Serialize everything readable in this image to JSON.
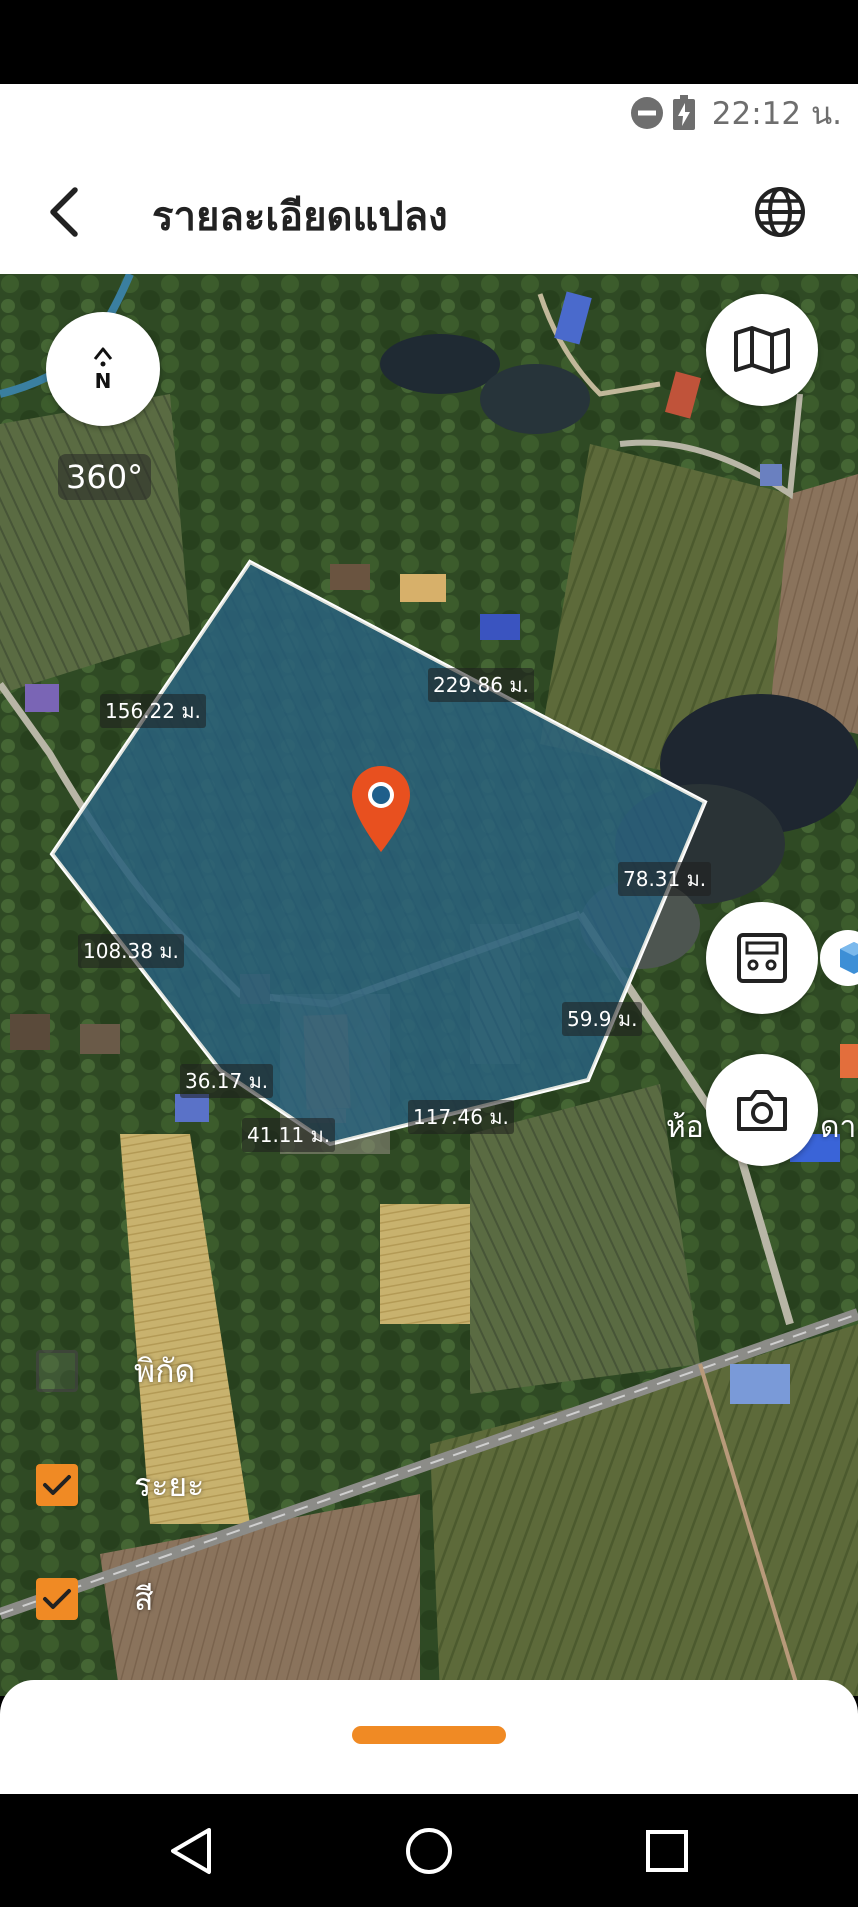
{
  "status": {
    "time": "22:12 น.",
    "icons": [
      "do-not-disturb-icon",
      "battery-charging-icon"
    ]
  },
  "header": {
    "title": "รายละเอียดแปลง",
    "back_icon": "back-arrow-icon",
    "globe_icon": "globe-icon"
  },
  "map": {
    "compass_label": "N",
    "degree_label": "360°",
    "distances": [
      "156.22 ม.",
      "229.86 ม.",
      "78.31 ม.",
      "59.9 ม.",
      "117.46 ม.",
      "41.11 ม.",
      "36.17 ม.",
      "108.38 ม."
    ],
    "place_label": "ห้อ",
    "place_label_2": "ดา",
    "layers": [
      {
        "label": "พิกัด",
        "checked": false
      },
      {
        "label": "ระยะ",
        "checked": true
      },
      {
        "label": "สี",
        "checked": true
      }
    ],
    "colors": {
      "plot_fill": "#1f5f8b",
      "plot_stroke": "#ffffff",
      "pin": "#e8501f",
      "accent": "#f08a24"
    }
  },
  "nav": {
    "back": "nav-back-icon",
    "home": "nav-home-icon",
    "recents": "nav-recents-icon"
  }
}
